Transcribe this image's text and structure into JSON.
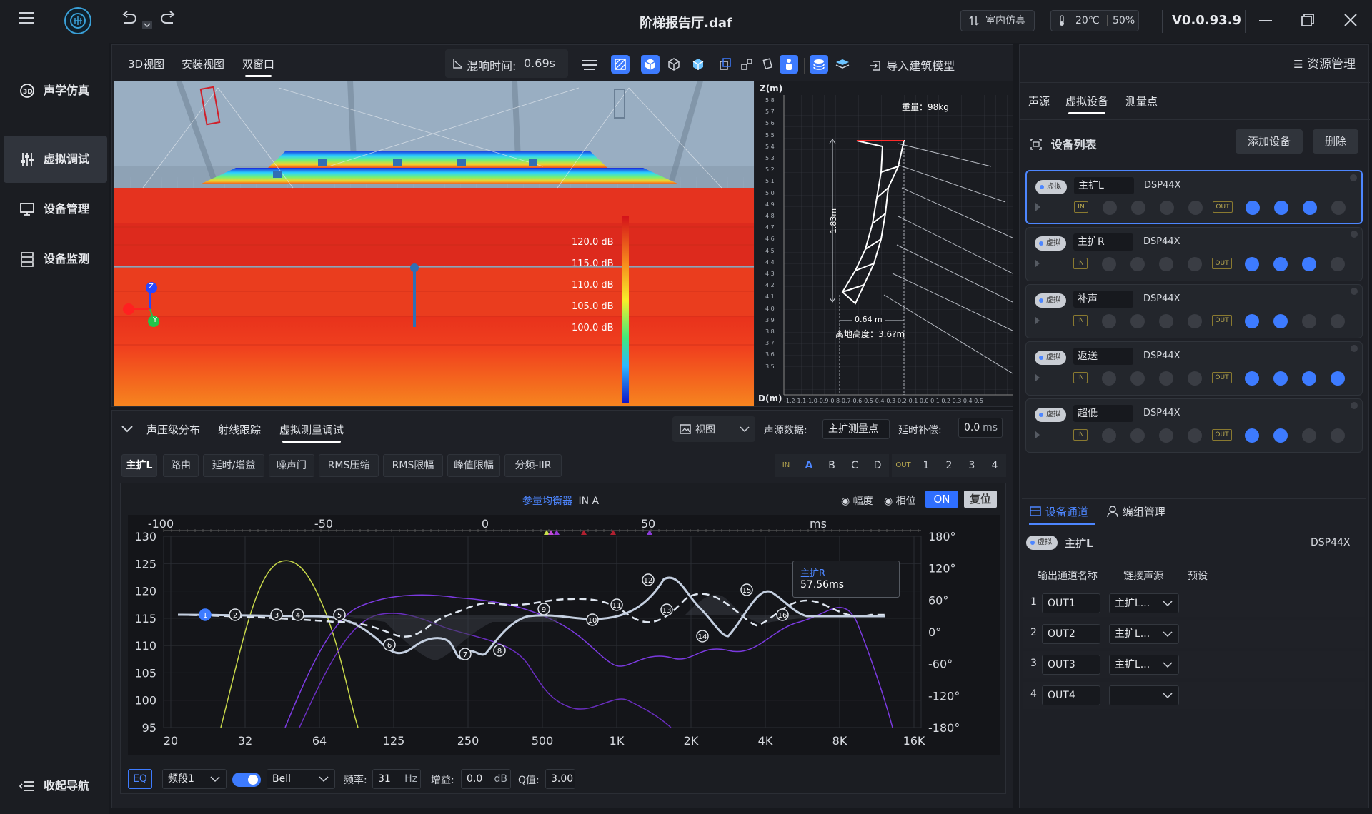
{
  "titlebar": {
    "file_title": "阶梯报告厅.daf",
    "env_mode": "室内仿真",
    "temperature": "20℃",
    "humidity": "50%",
    "version": "V0.0.93.9"
  },
  "sidebar": {
    "items": [
      {
        "label": "声学仿真"
      },
      {
        "label": "虚拟调试"
      },
      {
        "label": "设备管理"
      },
      {
        "label": "设备监测"
      }
    ],
    "collapse_label": "收起导航"
  },
  "viewport": {
    "tabs": [
      "3D视图",
      "安装视图",
      "双窗口"
    ],
    "reverb_label": "混响时间:",
    "reverb_value": "0.69s",
    "import_label": "导入建筑模型",
    "legend": [
      "120.0 dB",
      "115.0 dB",
      "110.0 dB",
      "105.0 dB",
      "100.0 dB"
    ],
    "axis_labels": {
      "z": "Z",
      "y": "Y"
    }
  },
  "array_view": {
    "z_axis_label": "Z(m)",
    "d_axis_label": "D(m)",
    "z_ticks": [
      "5.8",
      "5.7",
      "5.6",
      "5.5",
      "5.4",
      "5.3",
      "5.2",
      "5.1",
      "5.0",
      "4.9",
      "4.8",
      "4.7",
      "4.6",
      "4.5",
      "4.4",
      "4.3",
      "4.2",
      "4.1",
      "4.0",
      "3.9",
      "3.8",
      "3.7",
      "3.6",
      "3.5"
    ],
    "d_ticks": "-1.2-1.1-1.0-0.9-0.8-0.7-0.6-0.5-0.4-0.3-0.2-0.1 0.0 0.1 0.2 0.3 0.4 0.5",
    "weight": "重量：98kg",
    "height_dim": "1.83m",
    "width_dim": "0.64 m",
    "ground_height": "离地高度：3.6?m"
  },
  "bottom_panel": {
    "tabs": [
      "声压级分布",
      "射线跟踪",
      "虚拟测量调试"
    ],
    "view_label": "视图",
    "source_data_label": "声源数据:",
    "source_data_value": "主扩测量点",
    "delay_label": "延时补偿:",
    "delay_value": "0.0",
    "delay_unit": "ms",
    "subtabs": [
      "主扩L",
      "路由",
      "延时/增益",
      "噪声门",
      "RMS压缩",
      "RMS限幅",
      "峰值限幅",
      "分频-IIR"
    ],
    "in_label": "IN",
    "in_channels": [
      "A",
      "B",
      "C",
      "D"
    ],
    "out_label": "OUT",
    "out_channels": [
      "1",
      "2",
      "3",
      "4"
    ],
    "eq_title": "参量均衡器",
    "eq_channel": "IN A",
    "amplitude_label": "幅度",
    "phase_label": "相位",
    "on_label": "ON",
    "reset_label": "复位",
    "ms_label": "ms",
    "time_ticks": [
      "-100",
      "-50",
      "0",
      "50"
    ],
    "db_ticks": [
      "130",
      "125",
      "120",
      "115",
      "110",
      "105",
      "100",
      "95"
    ],
    "phase_ticks": [
      "180°",
      "120°",
      "60°",
      "0°",
      "-60°",
      "-120°",
      "-180°"
    ],
    "freq_ticks": [
      "20",
      "32",
      "64",
      "125",
      "250",
      "500",
      "1K",
      "2K",
      "4K",
      "8K",
      "16K"
    ],
    "tooltip_name": "主扩R",
    "tooltip_value": "57.56ms",
    "eq_points": [
      "1",
      "2",
      "3",
      "4",
      "5",
      "6",
      "7",
      "8",
      "9",
      "10",
      "11",
      "12",
      "13",
      "14",
      "15",
      "16"
    ],
    "footer": {
      "eq_label": "EQ",
      "band_label": "频段1",
      "filter_type": "Bell",
      "freq_label": "频率:",
      "freq_value": "31",
      "freq_unit": "Hz",
      "gain_label": "增益:",
      "gain_value": "0.0",
      "gain_unit": "dB",
      "q_label": "Q值:",
      "q_value": "3.00"
    }
  },
  "right_panel": {
    "header": "资源管理",
    "tabs": [
      "声源",
      "虚拟设备",
      "测量点"
    ],
    "device_list_title": "设备列表",
    "add_device": "添加设备",
    "delete": "删除",
    "virtual_badge": "虚拟",
    "devices": [
      {
        "name": "主扩L",
        "model": "DSP44X",
        "out": [
          true,
          true,
          true,
          false
        ]
      },
      {
        "name": "主扩R",
        "model": "DSP44X",
        "out": [
          true,
          true,
          true,
          false
        ]
      },
      {
        "name": "补声",
        "model": "DSP44X",
        "out": [
          true,
          true,
          false,
          false
        ]
      },
      {
        "name": "返送",
        "model": "DSP44X",
        "out": [
          true,
          true,
          true,
          true
        ]
      },
      {
        "name": "超低",
        "model": "DSP44X",
        "out": [
          true,
          true,
          false,
          false
        ]
      }
    ],
    "io_in": "IN",
    "io_out": "OUT",
    "channel_tabs": [
      "设备通道",
      "编组管理"
    ],
    "current_device_name": "主扩L",
    "current_device_model": "DSP44X",
    "columns": [
      "输出通道名称",
      "链接声源",
      "预设"
    ],
    "outputs": [
      {
        "index": "1",
        "name": "OUT1",
        "link": "主扩L..."
      },
      {
        "index": "2",
        "name": "OUT2",
        "link": "主扩L..."
      },
      {
        "index": "3",
        "name": "OUT3",
        "link": "主扩L..."
      },
      {
        "index": "4",
        "name": "OUT4",
        "link": ""
      }
    ]
  }
}
